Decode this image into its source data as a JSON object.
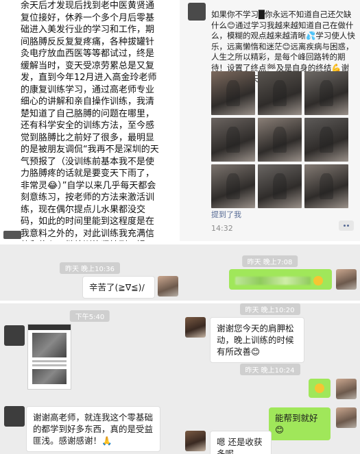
{
  "top_left": {
    "paragraph": "余天后才发现后找到老中医黄贤通复位接好，休养一个多个月后零基础进入美发行业的学习和工作，期间胳膊反反复复疼痛，各种拔罐针灸电疗放血西医等等都试过，终是缓解当时，变天受凉劳累总是又复发，直到今年12月进入高金玲老师的康复训练学习，通过高老师专业细心的讲解和亲自操作训练，我清楚知道了自己胳膊的问题在哪里，还有科学安全的训练方法，至今感觉到胳膊比之前好了很多，最明显的是被朋友调侃“我再不是深圳的天气预报了（没训练前基本我不是使力胳膊疼的话就是要变天下雨了，非常灵😂）”自学以来几乎每天都会刻意练习，按老师的方法来激活训练，现在偶尔提点儿水果都没交码，如此的时间里能到这程度是在我意料之外的，对此训练我充满信赖和信心，继续训练坚持到习惯，懂人的训练"
  },
  "top_right": {
    "post_text": "如果你不学习█你永远不知道自己还欠缺什么😊通过学习我越来越知道自己在做什么，模糊的观点越来越清晰💦学习使人快乐，远离懒惰和迷茫😊远离疾病与困惑，人生之所以精彩，是每个峰回路转的期待！设置了终点🏁及是自身的终结💪谢谢高老师三天的指导培训",
    "mention": "提到了我",
    "time": "14:32",
    "photo_colors": [
      "#7d6a5e",
      "#5a5550",
      "#6e6a66",
      "#6b6460",
      "#8a7f77",
      "#5d5a58",
      "#7c746e",
      "#6a6663",
      "#847b74"
    ]
  },
  "chat_a": {
    "time": "昨天 晚上10:36",
    "message": "辛苦了(≧∇≦)/"
  },
  "chat_b": {
    "time": "昨天 晚上7:08"
  },
  "chat_c": {
    "time": "下午5:40",
    "message": "谢谢高老师，就连我这个零基础的都学到好多东西，真的是受益匪浅。感谢感谢！🙏"
  },
  "chat_d": {
    "time1": "昨天 晚上10:20",
    "msg1": "谢谢您今天的肩胛松动，晚上训练的时候有所改善😊",
    "time2": "昨天 晚上10:24",
    "msg2": "能帮到就好😊",
    "msg3": "嗯 还是收获多呢"
  }
}
